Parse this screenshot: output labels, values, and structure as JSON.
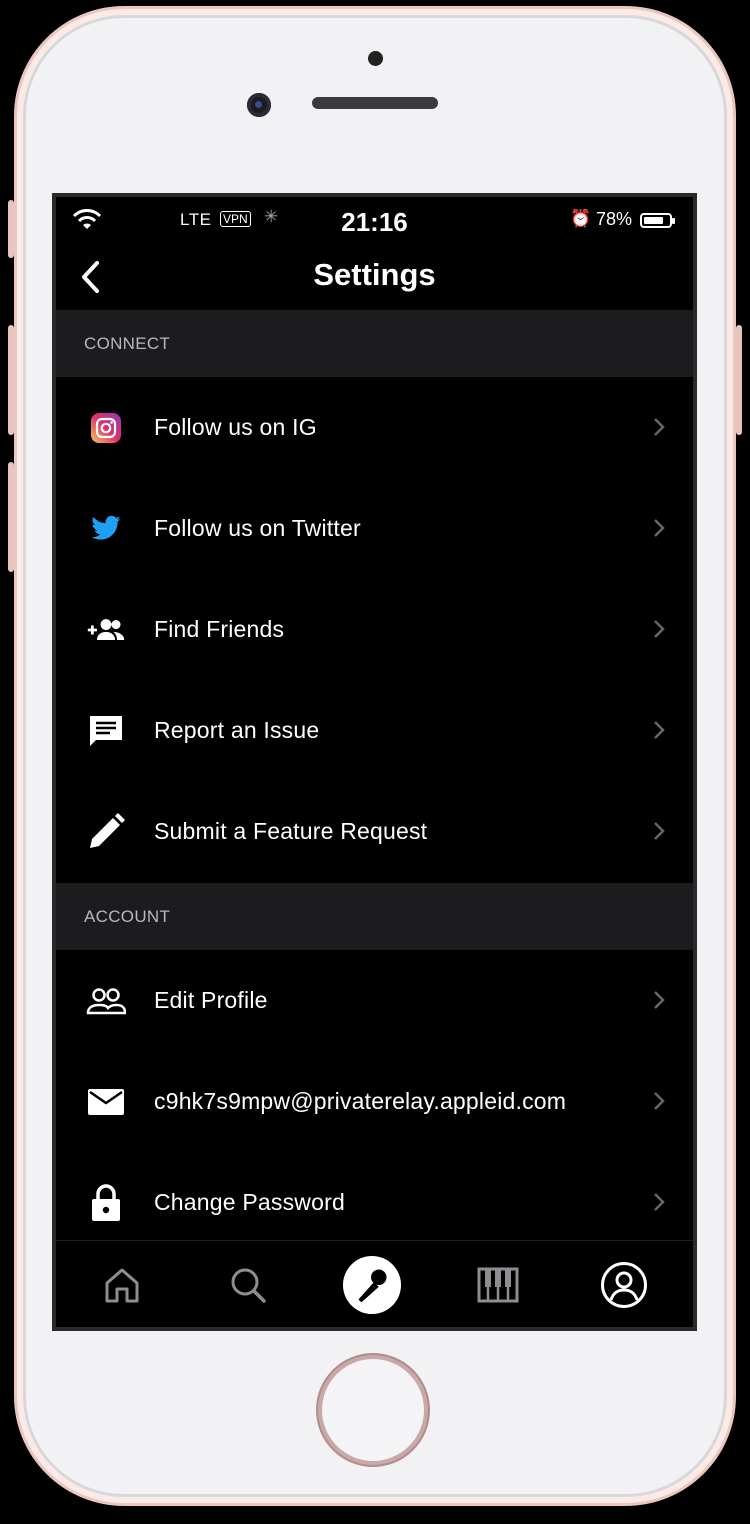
{
  "status_bar": {
    "carrier": "LTE",
    "vpn": "VPN",
    "time": "21:16",
    "battery": "78%",
    "battery_level": 0.78
  },
  "nav": {
    "title": "Settings"
  },
  "sections": {
    "connect": {
      "header": "CONNECT",
      "items": [
        {
          "label": "Follow us on IG",
          "icon": "instagram-icon"
        },
        {
          "label": "Follow us on Twitter",
          "icon": "twitter-icon"
        },
        {
          "label": "Find Friends",
          "icon": "add-friends-icon"
        },
        {
          "label": "Report an Issue",
          "icon": "message-icon"
        },
        {
          "label": "Submit a Feature Request",
          "icon": "pencil-icon"
        }
      ]
    },
    "account": {
      "header": "ACCOUNT",
      "items": [
        {
          "label": "Edit Profile",
          "icon": "people-icon"
        },
        {
          "label": "c9hk7s9mpw@privaterelay.appleid.com",
          "icon": "envelope-icon"
        },
        {
          "label": "Change Password",
          "icon": "lock-icon"
        }
      ]
    }
  },
  "tabbar": {
    "tabs": [
      "home-icon",
      "search-icon",
      "microphone-icon",
      "piano-icon",
      "profile-icon"
    ],
    "active": "profile-icon"
  },
  "colors": {
    "background": "#000000",
    "section_header_bg": "#1c1c1e",
    "instagram_gradient": [
      "#fdc95a",
      "#e1306c",
      "#8a3ab9"
    ],
    "twitter_blue": "#1da1f2"
  }
}
